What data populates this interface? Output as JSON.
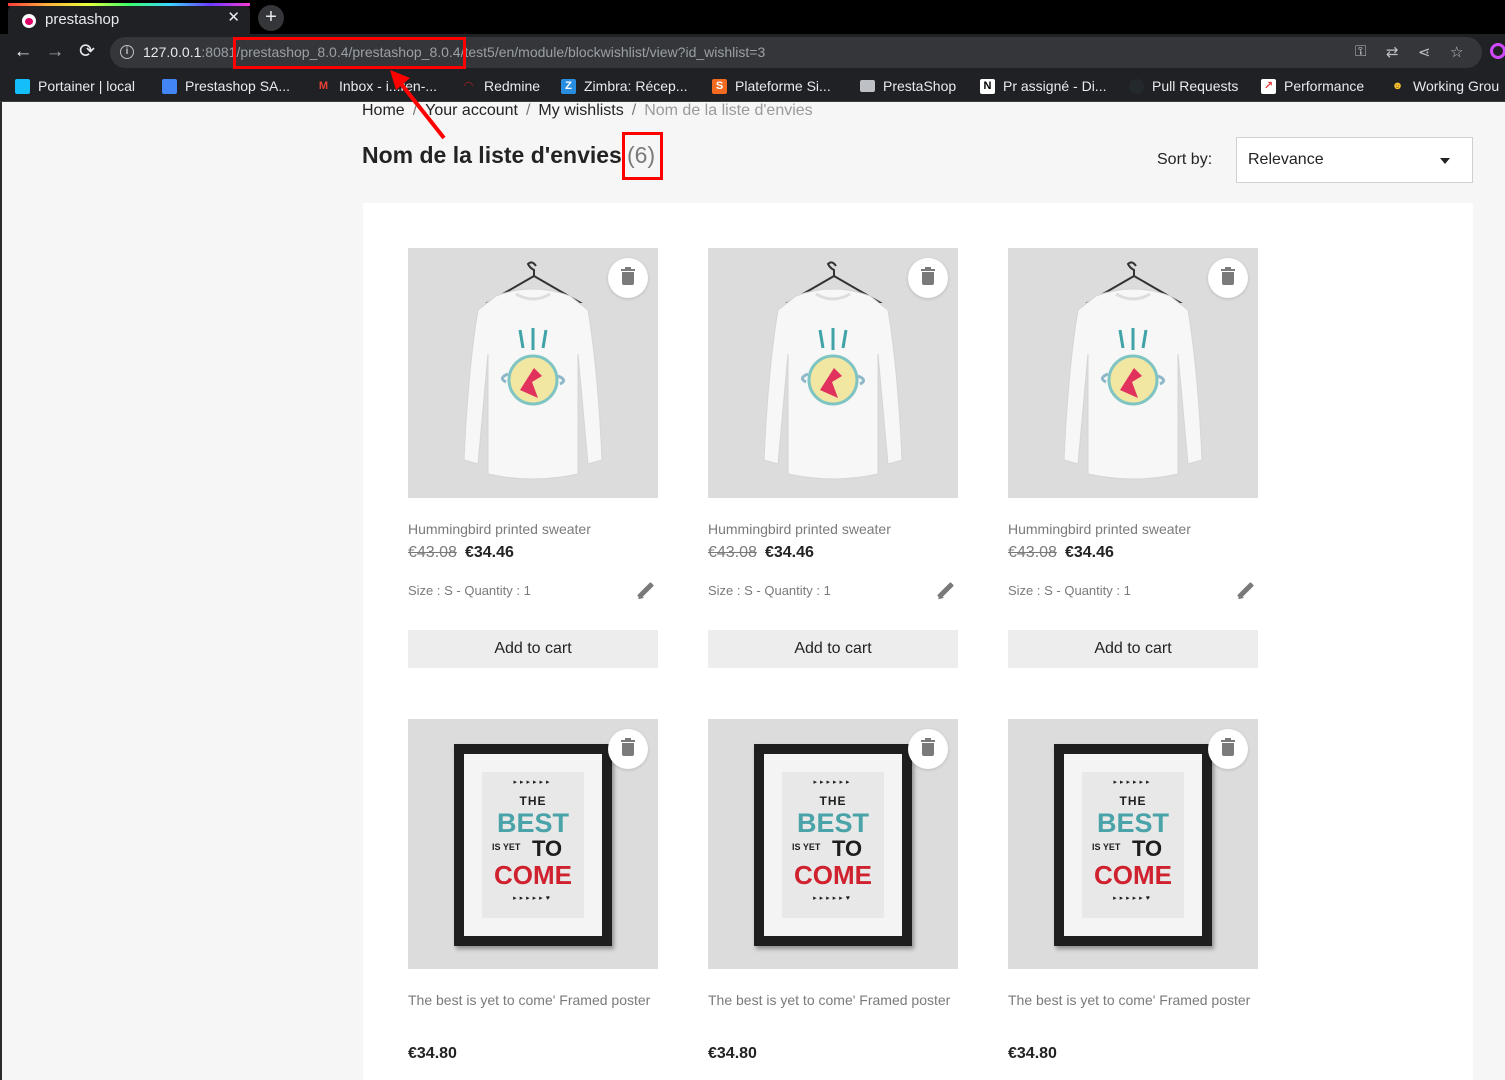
{
  "browser": {
    "tab_title": "prestashop",
    "tab_close": "✕",
    "new_tab": "+",
    "url_host": "127.0.0.1",
    "url_rest": ":8081/prestashop_8.0.4/prestashop_8.0.4/test5/en/module/blockwishlist/view?id_wishlist=3",
    "nav": {
      "back": "←",
      "forward": "→",
      "reload": "⟳"
    },
    "bookmarks": [
      {
        "label": "Portainer | local",
        "icon": "portainer-icon",
        "color": "#13bef9"
      },
      {
        "label": "Prestashop SA...",
        "icon": "calendar-icon",
        "color": "#4285f4"
      },
      {
        "label": "Inbox - i...ren-...",
        "icon": "gmail-icon",
        "color": "#ea4335"
      },
      {
        "label": "Redmine",
        "icon": "redmine-icon",
        "color": "#b32024"
      },
      {
        "label": "Zimbra: Récep...",
        "icon": "zimbra-icon",
        "color": "#2a8ee0"
      },
      {
        "label": "Plateforme Si...",
        "icon": "plateforme-icon",
        "color": "#f26b21"
      },
      {
        "label": "PrestaShop",
        "icon": "folder-icon",
        "color": "#bdc1c6"
      },
      {
        "label": "Pr assigné - Di...",
        "icon": "notion-icon",
        "color": "#ffffff"
      },
      {
        "label": "Pull Requests",
        "icon": "github-icon",
        "color": "#24292e"
      },
      {
        "label": "Performance",
        "icon": "chart-icon",
        "color": "#e53935"
      },
      {
        "label": "Working Grou",
        "icon": "emoji-icon",
        "color": "#f9c02e"
      }
    ]
  },
  "breadcrumb": {
    "items": [
      "Home",
      "Your account",
      "My wishlists"
    ],
    "current": "Nom de la liste d'envies",
    "separator": "/"
  },
  "wishlist": {
    "title": "Nom de la liste d'envies",
    "count": "(6)"
  },
  "sort": {
    "label": "Sort by:",
    "value": "Relevance"
  },
  "products": [
    {
      "name": "Hummingbird printed sweater",
      "old_price": "€43.08",
      "price": "€34.46",
      "attrs": "Size : S - Quantity : 1",
      "cta": "Add to cart",
      "image": "sweater"
    },
    {
      "name": "Hummingbird printed sweater",
      "old_price": "€43.08",
      "price": "€34.46",
      "attrs": "Size : S - Quantity : 1",
      "cta": "Add to cart",
      "image": "sweater"
    },
    {
      "name": "Hummingbird printed sweater",
      "old_price": "€43.08",
      "price": "€34.46",
      "attrs": "Size : S - Quantity : 1",
      "cta": "Add to cart",
      "image": "sweater"
    },
    {
      "name": "The best is yet to come' Framed poster",
      "price": "€34.80",
      "image": "poster"
    },
    {
      "name": "The best is yet to come' Framed poster",
      "price": "€34.80",
      "image": "poster"
    },
    {
      "name": "The best is yet to come' Framed poster",
      "price": "€34.80",
      "image": "poster"
    }
  ],
  "poster_art": {
    "line1": "THE",
    "line2": "BEST",
    "line3a": "IS YET",
    "line3b": "TO",
    "line4": "COME",
    "arrows_top": "▸▸▸▸▸▸",
    "arrows_bottom": "▸▸▸▸▸♥"
  },
  "colors": {
    "annotation": "#ff0000",
    "teal": "#4aa3a8",
    "red": "#d0212f"
  }
}
